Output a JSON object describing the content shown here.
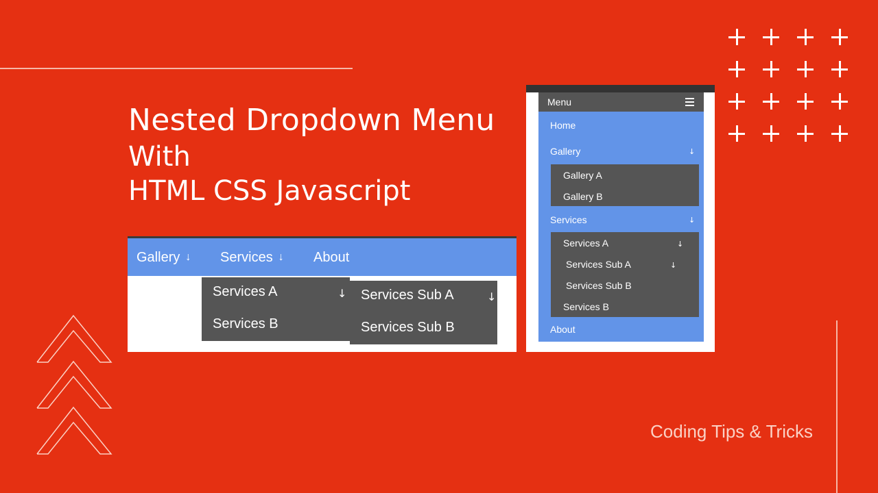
{
  "title": {
    "line1": "Nested Dropdown Menu",
    "line2": "With",
    "line3": "HTML CSS Javascript"
  },
  "brand": "Coding Tips & Tricks",
  "colors": {
    "background": "#e53012",
    "menu_blue": "#6294e8",
    "dropdown_gray": "#555555"
  },
  "icons": {
    "dropdown_arrow": "arrow-down-icon",
    "menu": "hamburger-icon",
    "decoration_plus": "plus-icon",
    "decoration_chevron": "chevron-up-icon"
  },
  "desktop_menu": {
    "items": [
      {
        "label": "Gallery",
        "arrow": "↓"
      },
      {
        "label": "Services",
        "arrow": "↓"
      },
      {
        "label": "About"
      }
    ],
    "services_dropdown": [
      {
        "label": "Services A",
        "arrow": "↓"
      },
      {
        "label": "Services B"
      }
    ],
    "services_a_submenu": [
      {
        "label": "Services Sub A",
        "arrow": "↓"
      },
      {
        "label": "Services Sub B"
      }
    ]
  },
  "mobile_menu": {
    "header": "Menu",
    "items": [
      {
        "label": "Home"
      },
      {
        "label": "Gallery",
        "arrow": "↓"
      },
      {
        "label": "Services",
        "arrow": "↓"
      },
      {
        "label": "About"
      }
    ],
    "gallery_submenu": [
      {
        "label": "Gallery A"
      },
      {
        "label": "Gallery B"
      }
    ],
    "services_submenu": [
      {
        "label": "Services A",
        "arrow": "↓"
      },
      {
        "label": "Services Sub A",
        "arrow": "↓"
      },
      {
        "label": "Services Sub B"
      },
      {
        "label": "Services B"
      }
    ]
  }
}
